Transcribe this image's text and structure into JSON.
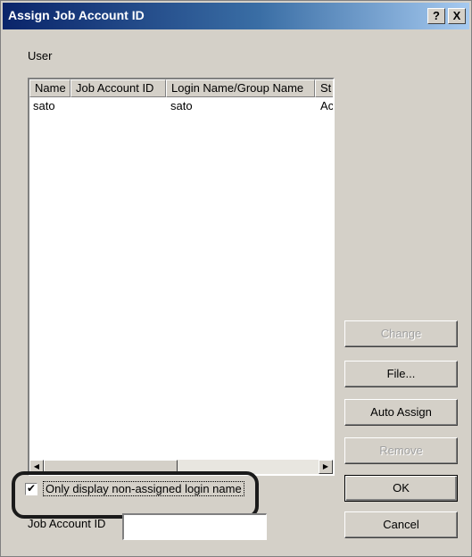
{
  "window": {
    "title": "Assign Job Account ID",
    "help_button": "?",
    "close_button": "X"
  },
  "user_group": {
    "label": "User"
  },
  "table": {
    "columns": [
      "Name",
      "Job Account ID",
      "Login Name/Group Name",
      "St"
    ],
    "rows": [
      {
        "name": "sato",
        "job_account_id": "",
        "login_name": "sato",
        "status": "Ac"
      }
    ]
  },
  "buttons": {
    "change": "Change",
    "file": "File...",
    "auto_assign": "Auto Assign",
    "remove": "Remove",
    "ok": "OK",
    "cancel": "Cancel"
  },
  "filter": {
    "checkbox_label": "Only display non-assigned login name",
    "checked": true,
    "check_mark": "✔"
  },
  "job_account_id_field": {
    "label": "Job Account ID",
    "value": ""
  }
}
